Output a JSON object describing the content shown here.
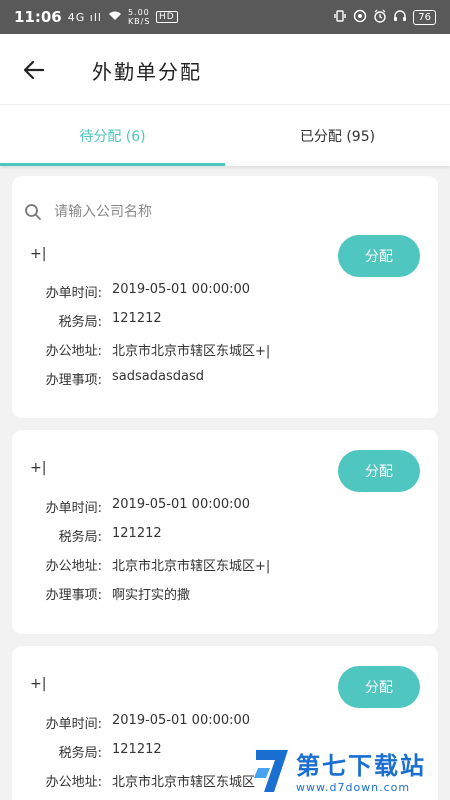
{
  "status_bar": {
    "time": "11:06",
    "signal": "4G ıll",
    "network_speed": "5.00 KB/S",
    "hd": "HD",
    "battery": "76"
  },
  "header": {
    "title": "外勤单分配"
  },
  "tabs": [
    {
      "label": "待分配 (6)",
      "active": true
    },
    {
      "label": "已分配 (95)",
      "active": false
    }
  ],
  "search": {
    "placeholder": "请输入公司名称"
  },
  "labels": {
    "time": "办单时间:",
    "bureau": "税务局:",
    "address": "办公地址:",
    "matter": "办理事项:",
    "assign": "分配"
  },
  "orders": [
    {
      "name": "+|",
      "time": "2019-05-01 00:00:00",
      "bureau": "121212",
      "address": "北京市北京市辖区东城区+|",
      "matter": "sadsadasdasd"
    },
    {
      "name": "+|",
      "time": "2019-05-01 00:00:00",
      "bureau": "121212",
      "address": "北京市北京市辖区东城区+|",
      "matter": "啊实打实的撒"
    },
    {
      "name": "+|",
      "time": "2019-05-01 00:00:00",
      "bureau": "121212",
      "address": "北京市北京市辖区东城区"
    }
  ],
  "watermark": {
    "cn": "第七下载站",
    "url": "www.d7down.com"
  },
  "colors": {
    "accent": "#4fc6bf",
    "status_bar": "#595959"
  }
}
